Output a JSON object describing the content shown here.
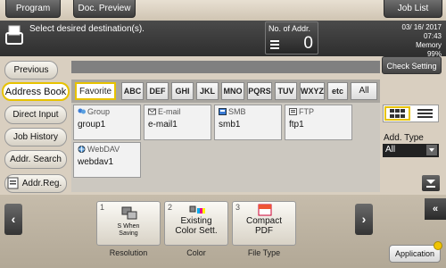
{
  "top_tabs": {
    "program": "Program",
    "doc_preview": "Doc. Preview",
    "job_list": "Job List"
  },
  "header": {
    "message": "Select desired destination(s).",
    "addr_count_label": "No. of Addr.",
    "addr_count_value": "0",
    "date": "03/ 16/ 2017",
    "time": "07:43",
    "memory_label": "Memory",
    "memory_value": "99%"
  },
  "buttons": {
    "previous": "Previous",
    "check_setting": "Check Setting"
  },
  "sidebar": {
    "items": [
      {
        "label": "Address Book",
        "active": true
      },
      {
        "label": "Direct Input"
      },
      {
        "label": "Job History"
      },
      {
        "label": "Addr. Search"
      },
      {
        "label": "Addr.Reg."
      }
    ]
  },
  "index_tabs": [
    "Favorite",
    "ABC",
    "DEF",
    "GHI",
    "JKL",
    "MNO",
    "PQRS",
    "TUV",
    "WXYZ",
    "etc",
    "All"
  ],
  "destinations": [
    {
      "type": "Group",
      "name": "group1",
      "icon": "group-icon"
    },
    {
      "type": "E-mail",
      "name": "e-mail1",
      "icon": "email-icon"
    },
    {
      "type": "SMB",
      "name": "smb1",
      "icon": "smb-icon"
    },
    {
      "type": "FTP",
      "name": "ftp1",
      "icon": "ftp-icon"
    },
    {
      "type": "WebDAV",
      "name": "webdav1",
      "icon": "webdav-icon"
    }
  ],
  "add_type": {
    "label": "Add. Type",
    "value": "All"
  },
  "functions": [
    {
      "num": "1",
      "label": "S When\nSaving",
      "caption": "Resolution"
    },
    {
      "num": "2",
      "label": "Existing\nColor Sett.",
      "caption": "Color"
    },
    {
      "num": "3",
      "label": "Compact\nPDF",
      "caption": "File Type"
    }
  ],
  "application_label": "Application",
  "colors": {
    "accent": "#e7c200",
    "dark": "#2e2e2e",
    "panel": "#d9cfc0"
  }
}
